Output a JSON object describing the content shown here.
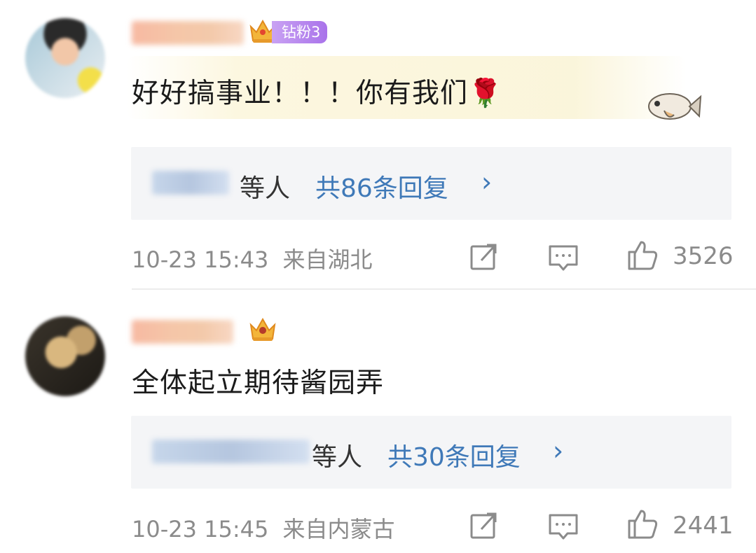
{
  "comments": [
    {
      "badge": "钻粉3",
      "text": "好好搞事业！！！你有我们🌹",
      "reply_suffix": "等人",
      "reply_count": "共86条回复",
      "reply_chevron": "›",
      "timestamp": "10-23 15:43",
      "location": "来自湖北",
      "likes": "3526"
    },
    {
      "text": "全体起立期待酱园弄",
      "reply_suffix": "等人",
      "reply_count": "共30条回复",
      "reply_chevron": "›",
      "timestamp": "10-23 15:45",
      "location": "来自内蒙古",
      "likes": "2441"
    }
  ],
  "colors": {
    "reply_link": "#3f79b8",
    "meta_gray": "#8b8b8b",
    "reply_bg": "#f4f5f7",
    "badge_purple": "#a973ea"
  },
  "icons": [
    "crown-icon",
    "fish-sticker-icon",
    "share-icon",
    "comment-icon",
    "like-icon",
    "chevron-right-icon"
  ]
}
